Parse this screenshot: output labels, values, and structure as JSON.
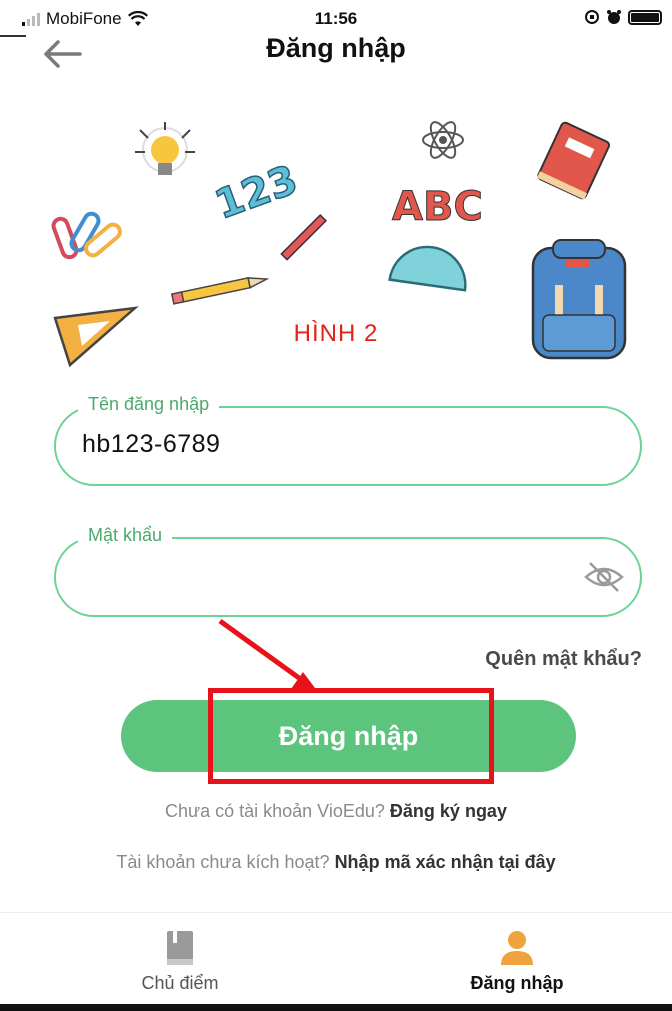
{
  "status_bar": {
    "carrier": "MobiFone",
    "time": "11:56"
  },
  "header": {
    "title": "Đăng nhập"
  },
  "illustration": {
    "caption": "HÌNH 2",
    "text_123": "123",
    "text_abc": "ABC"
  },
  "form": {
    "username_label": "Tên đăng nhập",
    "username_value": "hb123-6789",
    "password_label": "Mật khẩu",
    "password_value": "",
    "forgot_password": "Quên mật khẩu?",
    "login_button": "Đăng nhập"
  },
  "register": {
    "prompt": "Chưa có tài khoản VioEdu?",
    "link": "Đăng ký ngay"
  },
  "activate": {
    "prompt": "Tài khoản chưa kích hoạt?",
    "link": "Nhập mã xác nhận tại đây"
  },
  "bottom_nav": {
    "items": [
      {
        "label": "Chủ điểm",
        "icon": "book-icon",
        "active": false
      },
      {
        "label": "Đăng nhập",
        "icon": "user-icon",
        "active": true
      }
    ]
  },
  "colors": {
    "primary_green": "#5cc47c",
    "field_border": "#6dd394",
    "annotation_red": "#e8121a",
    "user_icon_orange": "#f0a23c"
  }
}
